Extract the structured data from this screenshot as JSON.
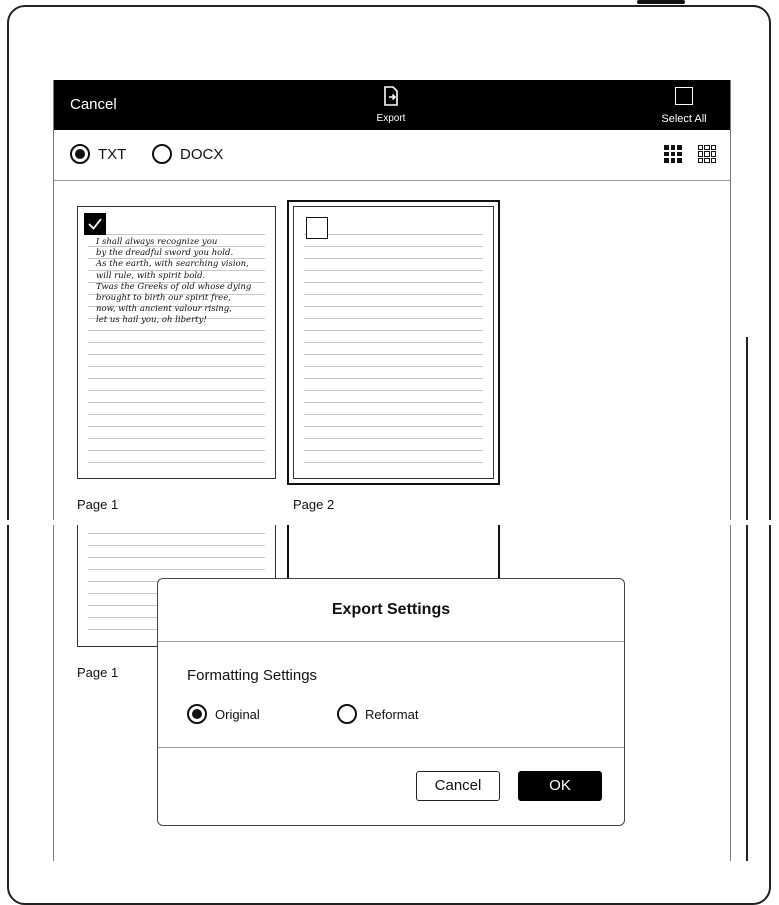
{
  "topbar": {
    "cancel_label": "Cancel",
    "export_label": "Export",
    "select_all_label": "Select All"
  },
  "format": {
    "options": [
      "TXT",
      "DOCX"
    ],
    "selected": "TXT"
  },
  "pages": [
    {
      "label": "Page 1",
      "checked": true,
      "handwriting": [
        "I shall always recognize you",
        "by the dreadful sword you hold.",
        "As the earth, with searching vision,",
        "will rule, with spirit bold.",
        "Twas the Greeks of old whose dying",
        "brought to birth our spirit free,",
        "now, with ancient valour rising,",
        "let us hail you, oh liberty!"
      ]
    },
    {
      "label": "Page 2",
      "checked": false
    }
  ],
  "dialog": {
    "title": "Export Settings",
    "section_label": "Formatting Settings",
    "options": [
      "Original",
      "Reformat"
    ],
    "selected": "Original",
    "cancel_label": "Cancel",
    "ok_label": "OK"
  },
  "icons": {
    "export": "export-icon",
    "select_all": "select-all-checkbox-icon",
    "view_large": "grid-large-icon",
    "view_small": "grid-small-icon"
  }
}
